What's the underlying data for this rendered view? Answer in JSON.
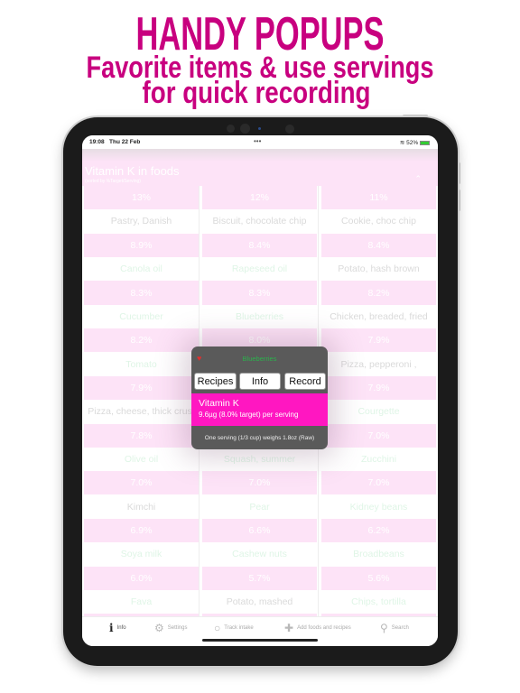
{
  "headline": {
    "line1": "HANDY POPUPS",
    "line2": "Favorite items & use servings",
    "line3": "for quick recording"
  },
  "colors": {
    "headline": "#c8007f",
    "row_pink": "#fde3f7",
    "popup_magenta": "#ff17c1",
    "green_name": "#dff5e6",
    "grey_name": "#dadada"
  },
  "status": {
    "time": "19:08",
    "date": "Thu 22 Feb",
    "dots": "•••",
    "battery": "52%"
  },
  "page": {
    "title": "Vitamin K in foods",
    "subtitle": "(sorted by %Target/Serving)",
    "collapse_icon": "chevron-up-icon"
  },
  "rows": [
    {
      "pcts": [
        "13%",
        "12%",
        "11%"
      ],
      "names": [
        "Pastry, Danish",
        "Biscuit, chocolate chip",
        "Cookie, choc chip"
      ],
      "tints": [
        "grey",
        "grey",
        "grey"
      ]
    },
    {
      "pcts": [
        "8.9%",
        "8.4%",
        "8.4%"
      ],
      "names": [
        "Canola oil",
        "Rapeseed oil",
        "Potato, hash brown"
      ],
      "tints": [
        "green",
        "green",
        "grey"
      ]
    },
    {
      "pcts": [
        "8.3%",
        "8.3%",
        "8.2%"
      ],
      "names": [
        "Cucumber",
        "Blueberries",
        "Chicken, breaded, fried"
      ],
      "tints": [
        "green",
        "green",
        "grey"
      ]
    },
    {
      "pcts": [
        "8.2%",
        "8.0%",
        "7.9%"
      ],
      "names": [
        "Tomato",
        "",
        "Pizza, pepperoni ,"
      ],
      "tints": [
        "green",
        "green",
        "grey"
      ]
    },
    {
      "pcts": [
        "7.9%",
        "",
        "7.9%"
      ],
      "names": [
        "Pizza, cheese, thick crust",
        "",
        "Courgette"
      ],
      "tints": [
        "grey",
        "grey",
        "green"
      ]
    },
    {
      "pcts": [
        "7.8%",
        "",
        "7.0%"
      ],
      "names": [
        "Olive oil",
        "Squash, summer",
        "Zucchini"
      ],
      "tints": [
        "green",
        "green",
        "green"
      ]
    },
    {
      "pcts": [
        "7.0%",
        "7.0%",
        "7.0%"
      ],
      "names": [
        "Kimchi",
        "Pear",
        "Kidney beans"
      ],
      "tints": [
        "grey",
        "green",
        "green"
      ]
    },
    {
      "pcts": [
        "6.9%",
        "6.6%",
        "6.2%"
      ],
      "names": [
        "Soya milk",
        "Cashew nuts",
        "Broadbeans"
      ],
      "tints": [
        "green",
        "green",
        "green"
      ]
    },
    {
      "pcts": [
        "6.0%",
        "5.7%",
        "5.6%"
      ],
      "names": [
        "Fava",
        "Potato, mashed",
        "Chips, tortilla"
      ],
      "tints": [
        "green",
        "grey",
        "green"
      ]
    }
  ],
  "popup": {
    "title": "Blueberries",
    "buttons": [
      "Recipes",
      "Info",
      "Record"
    ],
    "nutrient": "Vitamin K",
    "detail": "9.6µg (8.0% target) per serving",
    "footer": "One serving (1/3 cup) weighs 1.8oz (Raw)"
  },
  "tabs": [
    {
      "label": "Info",
      "icon": "info-icon",
      "selected": true
    },
    {
      "label": "Settings",
      "icon": "gear-icon"
    },
    {
      "label": "Track intake",
      "icon": "circle-icon"
    },
    {
      "label": "Add foods and recipes",
      "icon": "plus-icon"
    },
    {
      "label": "Search",
      "icon": "search-icon"
    }
  ]
}
